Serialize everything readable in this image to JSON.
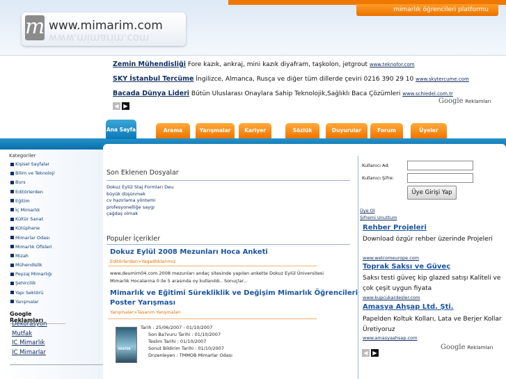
{
  "header": {
    "platform_label": "mimarlık öğrencileri platformu",
    "logo_letter": "m",
    "logo_text": "www.mimarim.com"
  },
  "top_ads": [
    {
      "title": "Zemin Mühendisliği",
      "desc": "Fore kazık, ankraj, mini kazık diyafram, taşkolon, jetgrout",
      "url": "www.teknofor.com"
    },
    {
      "title": "SKY İstanbul Tercüme",
      "desc": "İngilizce, Almanca, Rusça ve diğer tüm dillerde çeviri 0216 390 29 10",
      "url": "www.skytercume.com"
    },
    {
      "title": "Bacada Dünya Lideri",
      "desc": "Bütün Uluslarası Onaylara Sahip Teknolojik,Sağlıklı Baca Çözümleri",
      "url": "www.schiedel.com.tr"
    }
  ],
  "google_ads_label": {
    "brand": "Google",
    "suffix": "Reklamları"
  },
  "tabs": [
    "Ana Sayfa",
    "Arama",
    "Yarışmalar",
    "Kariyer",
    "Sözlük",
    "Duyurular",
    "Forum",
    "Üyeler"
  ],
  "sidebar": {
    "title": "Kategoriler",
    "categories": [
      "Kişisel Sayfalar",
      "Bilim ve Teknoloji",
      "Burs",
      "Editörlerden",
      "Eğitim",
      "İç Mimarlık",
      "Kültür Sanat",
      "Kütüphane",
      "Mimarlar Odası",
      "Mimarlık Ofisleri",
      "Mizah",
      "Mühendislik",
      "Peyzaj Mimarlığı",
      "Şehircilik",
      "Yapı Sektörü",
      "Yarışmalar"
    ],
    "ads_title": "Google Reklamları",
    "ad_links": [
      "Dekorasyon",
      "Mutfak",
      "IC Mimarlık",
      "IC Mimarlar"
    ]
  },
  "recent_files": {
    "title": "Son Eklenen Dosyalar",
    "items": [
      "Dokuz Eylül Staj Formları Deu",
      "büyük düşünmek",
      "cv hazırlama yöntemi",
      "profesyonelliğe saygı",
      "çağdaş olmak"
    ]
  },
  "popular": {
    "title": "Populer İçerikler",
    "articles": [
      {
        "title": "Dokuz Eylül 2008 Mezunları Hoca Anketi",
        "category": "Editörlerden>Yagadhklarımız",
        "text_lines": [
          "www.deumim04.com 2008 mezunları andaç sitesinde yapılan ankette Dokuz Eylül Üniversitesi",
          "Mimarlık Hocalarına 0 ile 5 arasında oy kullanıldı.. Sonuçlar..."
        ]
      },
      {
        "title_lines": [
          "Mimarlık ve Eğitimi Sürekliklik ve Değişim Mimarlık Öğrencileri",
          "Poster Yarışması"
        ],
        "category": "Yarışmalar>Tasarım Yarışmaları",
        "thumb_text": "POSTER",
        "details": [
          "Tarih : 25/06/2007 - 01/10/2007",
          "Son Ba?vuru Tarihi : 01/10/2007",
          "Teslim Tarihi : 01/10/2007",
          "Sonut Bildirim Tarihi : 01/10/2007",
          "Dnzenleyen : TMMOB Mimarlar Odası"
        ]
      }
    ]
  },
  "login": {
    "username_label": "Kullanıcı Ad:",
    "password_label": "Kullanıcı Şifre:",
    "button": "Üye Girişi Yap",
    "register": "Üye Ol",
    "forgot": "Şifremi Unuttum"
  },
  "right_ads": [
    {
      "title": "Rehber Projeleri",
      "desc": "Download özgür rehber üzerinde Projeleri",
      "url": "www.welcomeurope.com"
    },
    {
      "title": "Toprak Saksı ve Güveç",
      "desc": "Saksı testi güveç kip glazed satışı Kaliteli ve çok çeşit uygun fiyata",
      "url": "www.kupcukardesler.com"
    },
    {
      "title": "Amasya Ahşap Ltd. Şti.",
      "desc": "Papelden Koltuk Kolları, Lata ve Berjer Kollar Üretiyoruz",
      "url": "www.amasyaahsap.com"
    }
  ],
  "colors": {
    "orange": "#f07800",
    "blue": "#0c79b6",
    "link": "#102e61"
  },
  "icons": [
    "prev-arrow-icon",
    "next-arrow-icon",
    "category-bullet-icon"
  ]
}
